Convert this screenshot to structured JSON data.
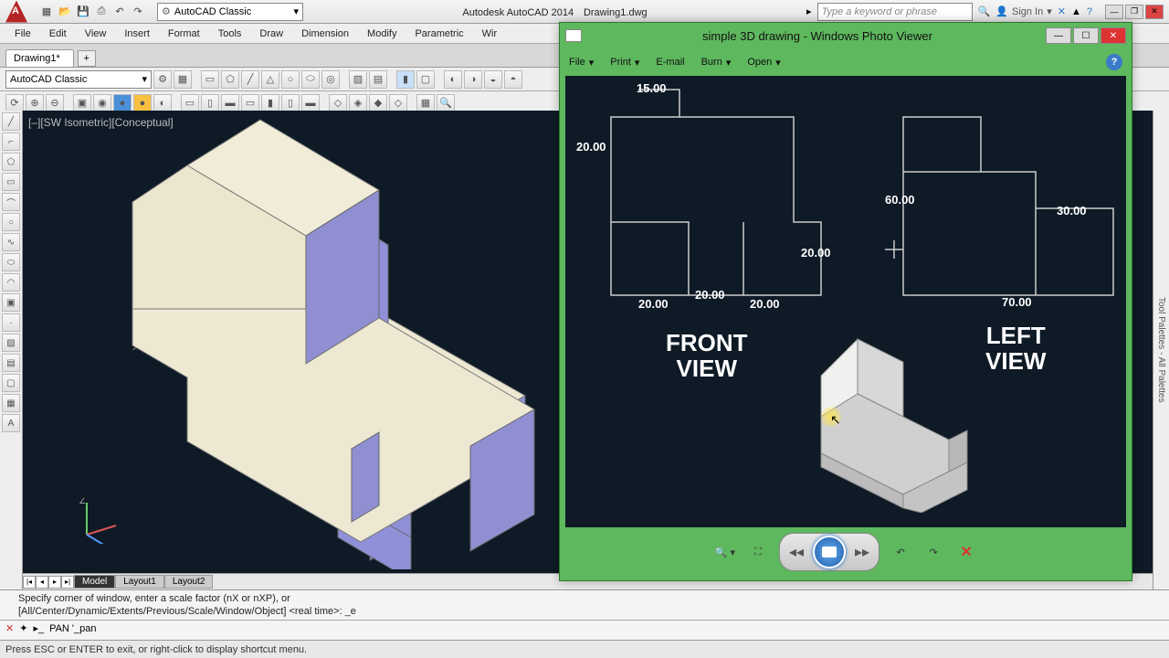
{
  "app": {
    "title": "Autodesk AutoCAD 2014",
    "document": "Drawing1.dwg",
    "workspace": "AutoCAD Classic",
    "search_placeholder": "Type a keyword or phrase",
    "signin": "Sign In"
  },
  "menu": {
    "file": "File",
    "edit": "Edit",
    "view": "View",
    "insert": "Insert",
    "format": "Format",
    "tools": "Tools",
    "draw": "Draw",
    "dimension": "Dimension",
    "modify": "Modify",
    "parametric": "Parametric",
    "window": "Wir"
  },
  "doctab": {
    "name": "Drawing1*"
  },
  "layer_sel": "AutoCAD Classic",
  "viewport": {
    "label": "[–][SW Isometric][Conceptual]"
  },
  "model_tabs": {
    "model": "Model",
    "layout1": "Layout1",
    "layout2": "Layout2"
  },
  "palette": "Tool Palettes - All Palettes",
  "cmd": {
    "line1": "Specify corner of window, enter a scale factor (nX or nXP), or",
    "line2": "[All/Center/Dynamic/Extents/Previous/Scale/Window/Object] <real time>: _e",
    "prompt": "PAN '_pan"
  },
  "status": "Press ESC or ENTER to exit, or right-click to display shortcut menu.",
  "pv": {
    "title": "simple 3D drawing - Windows Photo Viewer",
    "menu": {
      "file": "File",
      "print": "Print",
      "email": "E-mail",
      "burn": "Burn",
      "open": "Open"
    },
    "dims": {
      "d15": "15.00",
      "d20a": "20.00",
      "d20b": "20.00",
      "d20c": "20.00",
      "d20d": "20.00",
      "d20e": "20.00",
      "d60": "60.00",
      "d30": "30.00",
      "d70": "70.00"
    },
    "front": "FRONT\nVIEW",
    "left": "LEFT\nVIEW"
  }
}
